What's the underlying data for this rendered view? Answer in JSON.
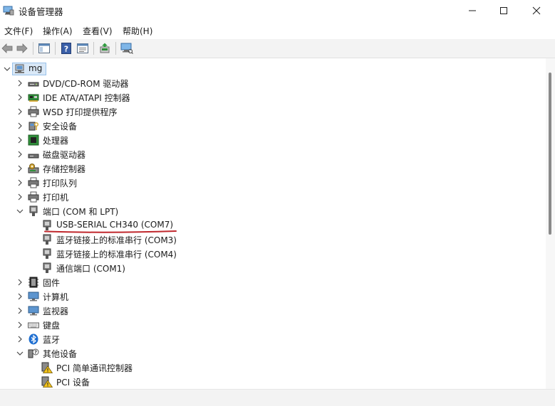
{
  "window": {
    "title": "设备管理器"
  },
  "menu": [
    {
      "label": "文件(F)"
    },
    {
      "label": "操作(A)"
    },
    {
      "label": "查看(V)"
    },
    {
      "label": "帮助(H)"
    }
  ],
  "tree": {
    "root": "mg",
    "categories": [
      {
        "label": "DVD/CD-ROM 驱动器",
        "icon": "dvd-drive-icon"
      },
      {
        "label": "IDE ATA/ATAPI 控制器",
        "icon": "ide-controller-icon"
      },
      {
        "label": "WSD 打印提供程序",
        "icon": "printer-icon"
      },
      {
        "label": "安全设备",
        "icon": "security-device-icon"
      },
      {
        "label": "处理器",
        "icon": "processor-icon"
      },
      {
        "label": "磁盘驱动器",
        "icon": "disk-drive-icon"
      },
      {
        "label": "存储控制器",
        "icon": "storage-controller-icon"
      },
      {
        "label": "打印队列",
        "icon": "printer-icon"
      },
      {
        "label": "打印机",
        "icon": "printer-icon"
      },
      {
        "label": "端口 (COM 和 LPT)",
        "icon": "port-icon",
        "expanded": true
      },
      {
        "label": "固件",
        "icon": "firmware-icon"
      },
      {
        "label": "计算机",
        "icon": "computer-icon"
      },
      {
        "label": "监视器",
        "icon": "monitor-icon"
      },
      {
        "label": "键盘",
        "icon": "keyboard-icon"
      },
      {
        "label": "蓝牙",
        "icon": "bluetooth-icon"
      },
      {
        "label": "其他设备",
        "icon": "other-devices-icon",
        "expanded": true
      }
    ],
    "ports_children": [
      {
        "label": "USB-SERIAL CH340 (COM7)"
      },
      {
        "label": "蓝牙链接上的标准串行 (COM3)"
      },
      {
        "label": "蓝牙链接上的标准串行 (COM4)"
      },
      {
        "label": "通信端口 (COM1)"
      }
    ],
    "other_children": [
      {
        "label": "PCI 简单通讯控制器"
      },
      {
        "label": "PCI 设备"
      }
    ]
  },
  "colors": {
    "annotation_underline": "#c0282d",
    "selection_fill": "#d9e8f7",
    "selection_border": "#99c2ea"
  }
}
